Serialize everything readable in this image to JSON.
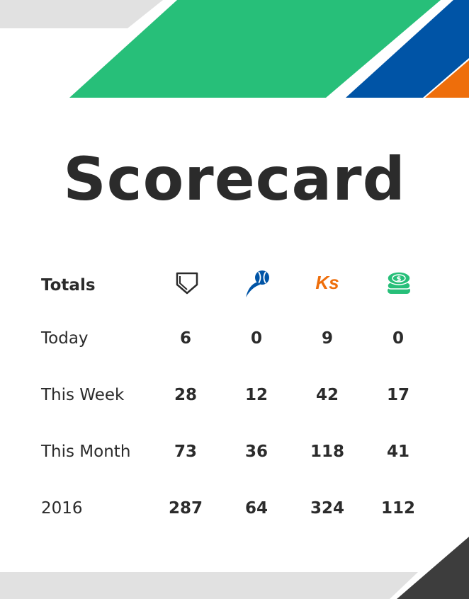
{
  "title": "Scorecard",
  "colors": {
    "green": "#27bf79",
    "blue": "#0054a6",
    "orange": "#ee6e0b",
    "gray": "#e0e0e0",
    "dark": "#3d3d3d",
    "text": "#2b2b2b"
  },
  "header": {
    "label": "Totals",
    "icons": [
      "home-plate-icon",
      "pitcher-ball-icon",
      "strikeouts-icon",
      "money-stack-icon"
    ],
    "ks_text": "Ks"
  },
  "rows": [
    {
      "label": "Today",
      "values": [
        "6",
        "0",
        "9",
        "0"
      ]
    },
    {
      "label": "This Week",
      "values": [
        "28",
        "12",
        "42",
        "17"
      ]
    },
    {
      "label": "This Month",
      "values": [
        "73",
        "36",
        "118",
        "41"
      ]
    },
    {
      "label": "2016",
      "values": [
        "287",
        "64",
        "324",
        "112"
      ]
    }
  ]
}
